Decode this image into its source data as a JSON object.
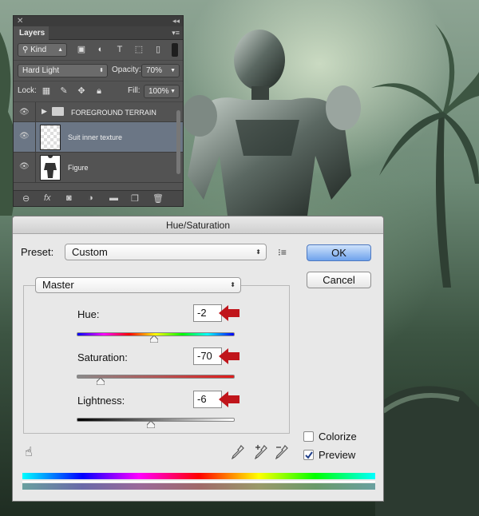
{
  "layers_panel": {
    "tab_label": "Layers",
    "filter_kind": "Kind",
    "blend_mode": "Hard Light",
    "opacity_label": "Opacity:",
    "opacity_value": "70%",
    "lock_label": "Lock:",
    "fill_label": "Fill:",
    "fill_value": "100%",
    "layers": [
      {
        "name": "FOREGROUND TERRAIN",
        "type": "group",
        "selected": false
      },
      {
        "name": "Suit inner texture",
        "type": "layer",
        "selected": true
      },
      {
        "name": "Figure",
        "type": "layer",
        "selected": false
      }
    ]
  },
  "dialog": {
    "title": "Hue/Saturation",
    "preset_label": "Preset:",
    "preset_value": "Custom",
    "channel_value": "Master",
    "ok_label": "OK",
    "cancel_label": "Cancel",
    "hue_label": "Hue:",
    "hue_value": "-2",
    "hue_level": 0.49,
    "saturation_label": "Saturation:",
    "saturation_value": "-70",
    "saturation_level": 0.15,
    "lightness_label": "Lightness:",
    "lightness_value": "-6",
    "lightness_level": 0.47,
    "colorize_label": "Colorize",
    "colorize_checked": false,
    "preview_label": "Preview",
    "preview_checked": true
  },
  "colors": {
    "arrow_red": "#c0151b",
    "ok_blue": "#6ea2ec",
    "panel_gray": "#535353",
    "selected_layer": "#6b7685"
  }
}
